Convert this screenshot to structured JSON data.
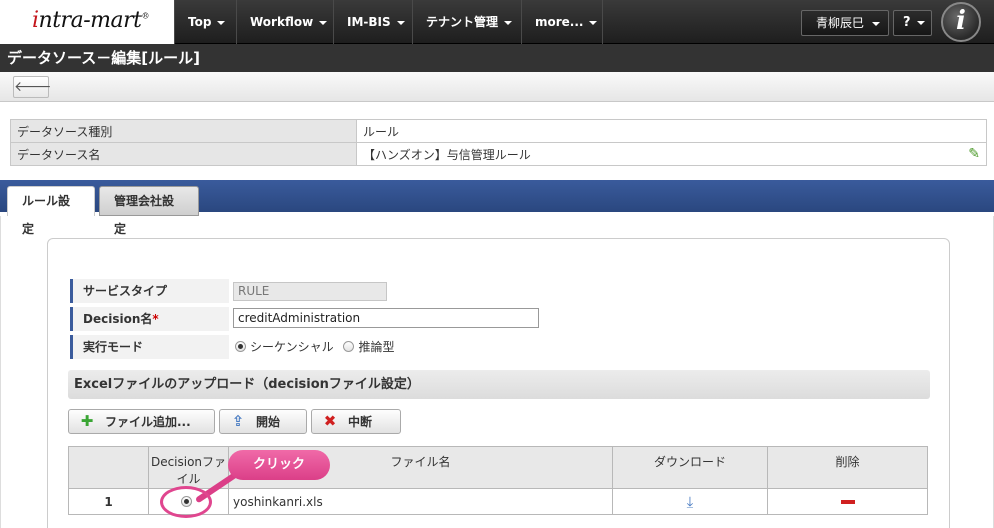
{
  "app": {
    "logo": "intra-mart"
  },
  "nav": {
    "items": [
      "Top",
      "Workflow",
      "IM-BIS",
      "テナント管理",
      "more..."
    ],
    "user": "青柳辰巳",
    "help": "?"
  },
  "page": {
    "title": "データソース－編集[ルール]"
  },
  "info": {
    "type_label": "データソース種別",
    "type_value": "ルール",
    "name_label": "データソース名",
    "name_value": "【ハンズオン】与信管理ルール"
  },
  "tabs": [
    "ルール設定",
    "管理会社設定"
  ],
  "form": {
    "service_type_label": "サービスタイプ",
    "service_type_value": "RULE",
    "decision_name_label": "Decision名",
    "required_mark": "*",
    "decision_name_value": "creditAdministration",
    "mode_label": "実行モード",
    "mode_options": [
      "シーケンシャル",
      "推論型"
    ],
    "mode_selected": "シーケンシャル"
  },
  "upload": {
    "section_title": "Excelファイルのアップロード（decisionファイル設定）",
    "add_button": "ファイル追加...",
    "start_button": "開始",
    "stop_button": "中断",
    "table": {
      "headers": [
        "",
        "Decisionファイル",
        "ファイル名",
        "ダウンロード",
        "削除"
      ],
      "rows": [
        {
          "no": "1",
          "file": "yoshinkanri.xls"
        }
      ]
    }
  },
  "callout": "クリック",
  "colors": {
    "tab_blue": "#2a477f",
    "highlight": "#e0468f"
  }
}
